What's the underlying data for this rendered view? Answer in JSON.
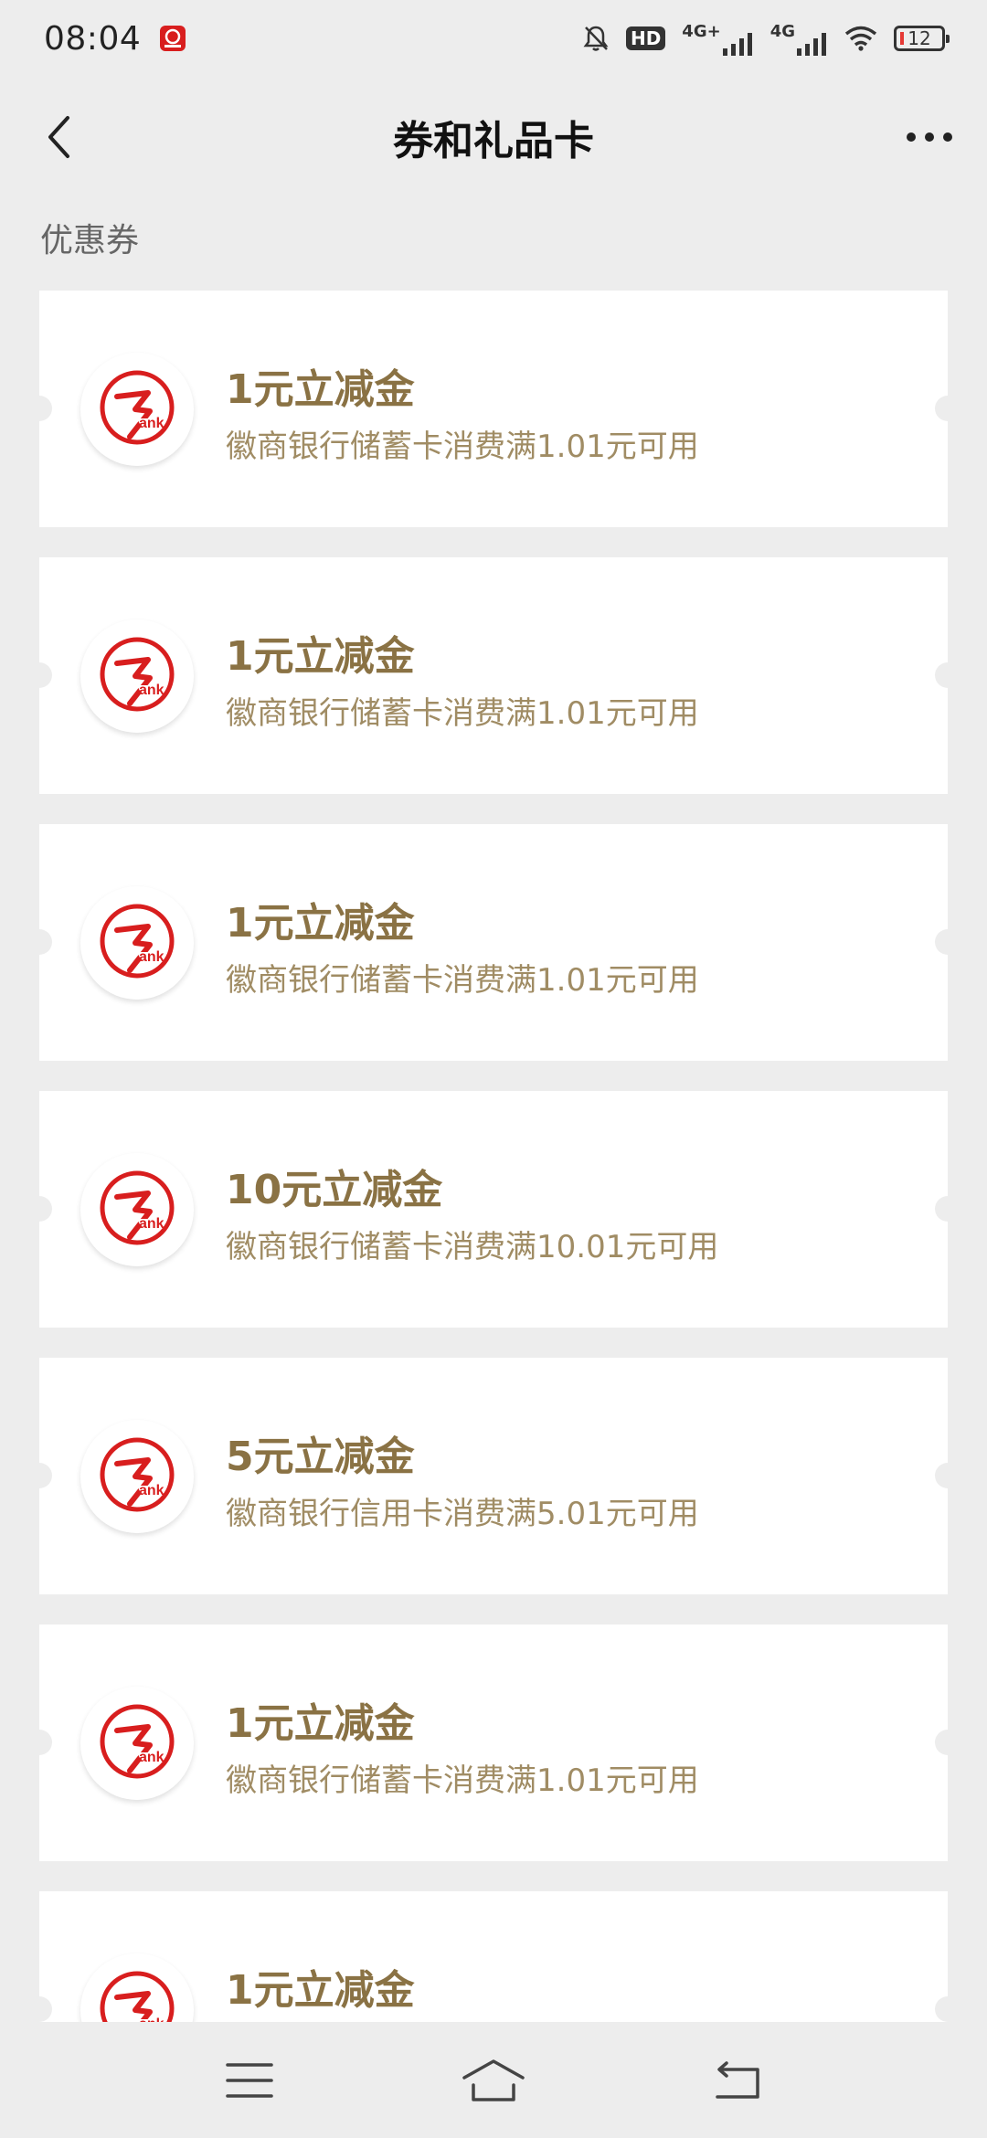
{
  "status_bar": {
    "time": "08:04",
    "hd_badge": "HD",
    "net_1": "4G+",
    "net_2": "4G",
    "battery": "12"
  },
  "header": {
    "title": "券和礼品卡"
  },
  "section": {
    "title": "优惠券"
  },
  "coupons": [
    {
      "title": "1元立减金",
      "desc": "徽商银行储蓄卡消费满1.01元可用"
    },
    {
      "title": "1元立减金",
      "desc": "徽商银行储蓄卡消费满1.01元可用"
    },
    {
      "title": "1元立减金",
      "desc": "徽商银行储蓄卡消费满1.01元可用"
    },
    {
      "title": "10元立减金",
      "desc": "徽商银行储蓄卡消费满10.01元可用"
    },
    {
      "title": "5元立减金",
      "desc": "徽商银行信用卡消费满5.01元可用"
    },
    {
      "title": "1元立减金",
      "desc": "徽商银行储蓄卡消费满1.01元可用"
    },
    {
      "title": "1元立减金",
      "desc": ""
    }
  ],
  "colors": {
    "coupon_title": "#8a7244",
    "coupon_desc": "#a08c64",
    "bank_logo_red": "#d81e1e",
    "background": "#ededed"
  },
  "icons": {
    "back": "chevron-left-icon",
    "more": "more-dots-icon",
    "bank_logo": "huishang-bank-logo",
    "sys_menu": "menu-lines-icon",
    "sys_home": "home-icon",
    "sys_back": "return-icon"
  }
}
